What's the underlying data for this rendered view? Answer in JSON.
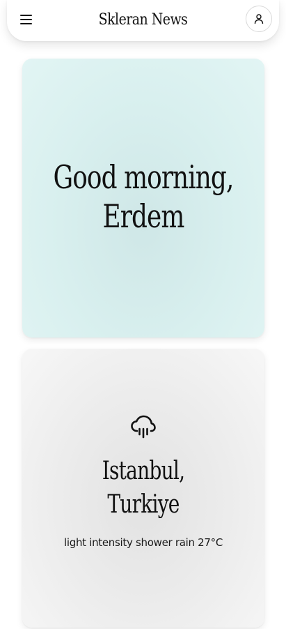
{
  "header": {
    "brand": "Skleran News",
    "menu_icon": "hamburger-menu-icon",
    "profile_icon": "user-icon"
  },
  "greeting": {
    "line1": "Good morning,",
    "line2": "Erdem"
  },
  "weather": {
    "icon": "cloud-rain-icon",
    "city_line1": "Istanbul,",
    "city_line2": "Turkiye",
    "description": "light intensity shower rain",
    "temperature": "27°C"
  },
  "colors": {
    "greeting_card_bg": "#d9f0ef",
    "weather_card_bg": "#ececec",
    "text": "#111111"
  }
}
